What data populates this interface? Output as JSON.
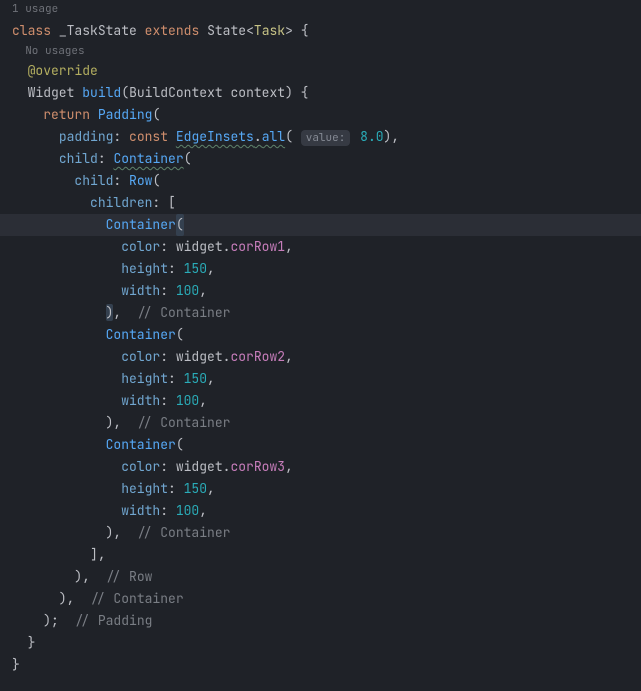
{
  "usage_hint_top": "1 usage",
  "l1": {
    "class_kw": "class",
    "class_name": "_TaskState",
    "extends_kw": "extends",
    "state": "State",
    "lt": "<",
    "task": "Task",
    "gt": ">",
    "brace": " {"
  },
  "usage_hint_inner": "No usages",
  "l2": {
    "annotation": "@override"
  },
  "l3": {
    "widget": "Widget",
    "build": "build",
    "open": "(",
    "ctx_type": "BuildContext",
    "ctx_name": " context",
    "close_brace": ") {"
  },
  "l4": {
    "return_kw": "return",
    "padding": "Padding",
    "open": "("
  },
  "l5": {
    "padding_label": "padding",
    "colon": ": ",
    "const_kw": "const",
    "edge": "EdgeInsets",
    "dot": ".",
    "all": "all",
    "open": "(",
    "hint": "value:",
    "num": "8.0",
    "close": "),"
  },
  "l6": {
    "child_label": "child",
    "colon": ": ",
    "container": "Container",
    "open": "("
  },
  "l7": {
    "child_label": "child",
    "colon": ": ",
    "row": "Row",
    "open": "("
  },
  "l8": {
    "children_label": "children",
    "colon": ": [",
    "open": ""
  },
  "c1": {
    "container": "Container",
    "open": "(",
    "color_label": "color",
    "colon": ": ",
    "widget": "widget",
    "dot": ".",
    "field": "corRow1",
    "comma": ",",
    "height_label": "height",
    "h": "150",
    "width_label": "width",
    "w": "100",
    "close": ")",
    "close_after": ",",
    "closing_comment": "// Container"
  },
  "c2": {
    "container": "Container",
    "open": "(",
    "color_label": "color",
    "colon": ": ",
    "widget": "widget",
    "dot": ".",
    "field": "corRow2",
    "comma": ",",
    "height_label": "height",
    "h": "150",
    "width_label": "width",
    "w": "100",
    "close": "),",
    "closing_comment": "// Container"
  },
  "c3": {
    "container": "Container",
    "open": "(",
    "color_label": "color",
    "colon": ": ",
    "widget": "widget",
    "dot": ".",
    "field": "corRow3",
    "comma": ",",
    "height_label": "height",
    "h": "150",
    "width_label": "width",
    "w": "100",
    "close": "),",
    "closing_comment": "// Container"
  },
  "close_children": "],",
  "close_row": {
    "close": "),",
    "comment": "// Row"
  },
  "close_container": {
    "close": "),",
    "comment": "// Container"
  },
  "close_padding": {
    "close": ");",
    "comment": "// Padding"
  },
  "close_method": "}",
  "close_class": "}"
}
